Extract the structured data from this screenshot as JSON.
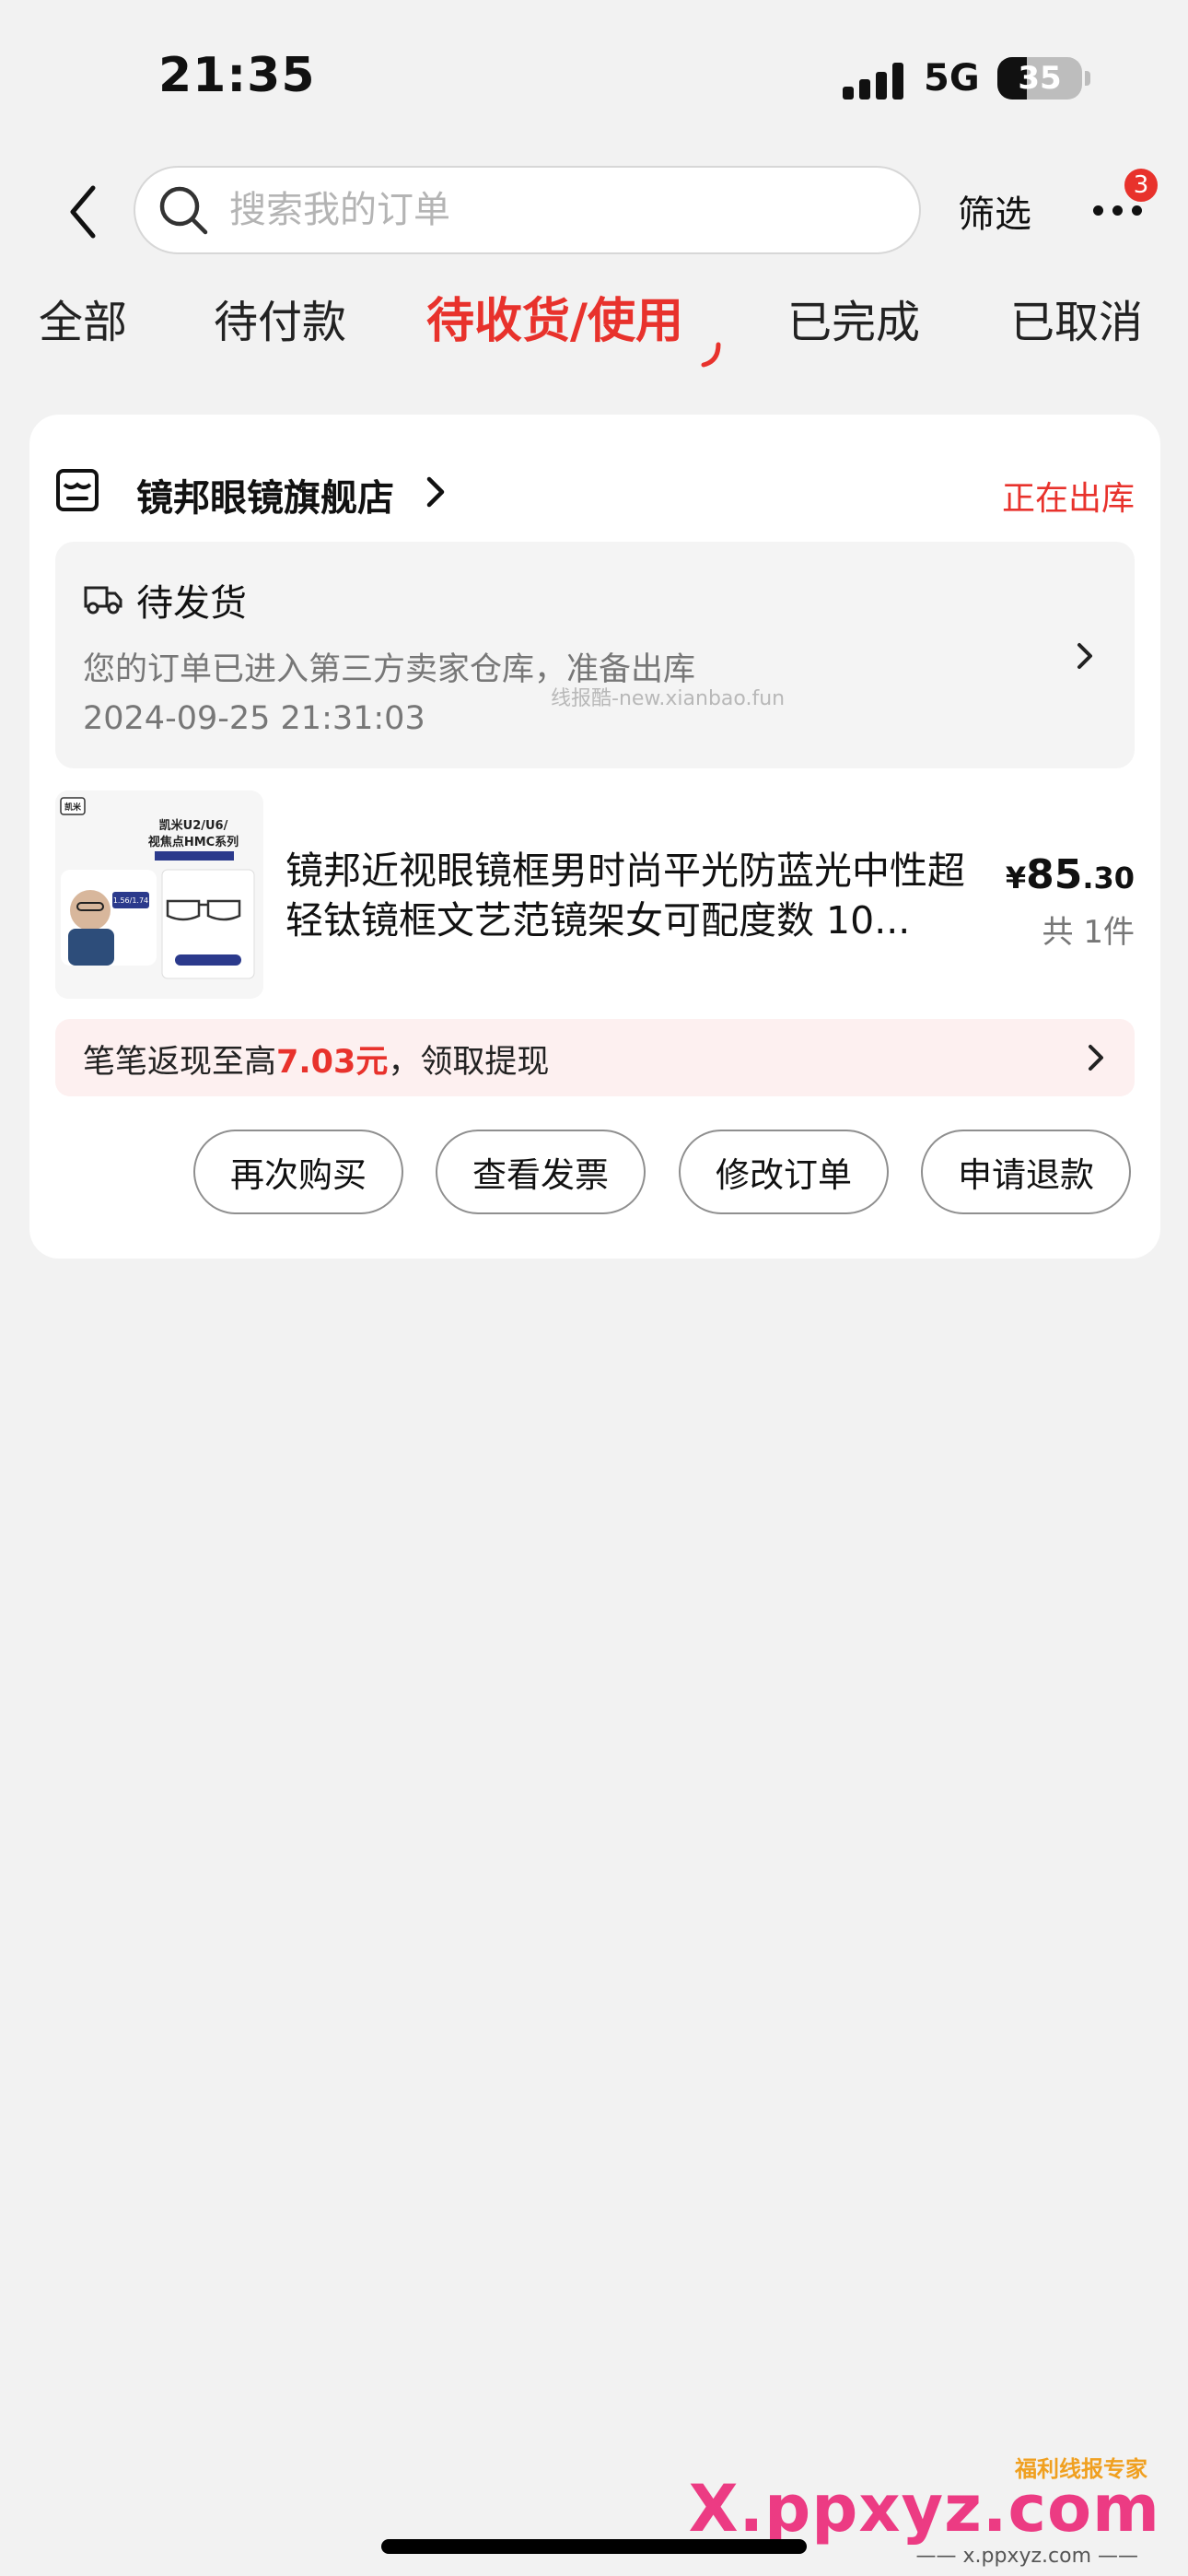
{
  "status_bar": {
    "time": "21:35",
    "network": "5G",
    "battery": "35"
  },
  "header": {
    "search_placeholder": "搜索我的订单",
    "filter_label": "筛选",
    "more_badge": "3"
  },
  "tabs": [
    {
      "label": "全部",
      "active": false
    },
    {
      "label": "待付款",
      "active": false
    },
    {
      "label": "待收货/使用",
      "active": true
    },
    {
      "label": "已完成",
      "active": false
    },
    {
      "label": "已取消",
      "active": false
    }
  ],
  "order": {
    "store_name": "镜邦眼镜旗舰店",
    "status": "正在出库",
    "shipping": {
      "title": "待发货",
      "description": "您的订单已进入第三方卖家仓库，准备出库",
      "time": "2024-09-25 21:31:03",
      "watermark": "线报酷-new.xianbao.fun"
    },
    "product": {
      "title": "镜邦近视眼镜框男时尚平光防蓝光中性超轻钛镜框文艺范镜架女可配度数 10...",
      "price_symbol": "¥",
      "price_int": "85",
      "price_dec": ".30",
      "quantity": "共 1件",
      "image": {
        "brand": "凯米",
        "series_line1": "凯米U2/U6/",
        "series_line2": "视焦点HMC系列",
        "index": "1.56/1.74"
      }
    },
    "cashback": {
      "prefix": "笔笔返现至高",
      "amount": "7.03元",
      "suffix": "，领取提现"
    },
    "actions": [
      "再次购买",
      "查看发票",
      "修改订单",
      "申请退款"
    ]
  },
  "watermark": {
    "top": "福利线报专家",
    "main": "X.ppxyz.com",
    "sub": "—— x.ppxyz.com ——"
  },
  "colors": {
    "accent": "#e8322c",
    "background": "#f2f2f2",
    "card": "#ffffff"
  }
}
